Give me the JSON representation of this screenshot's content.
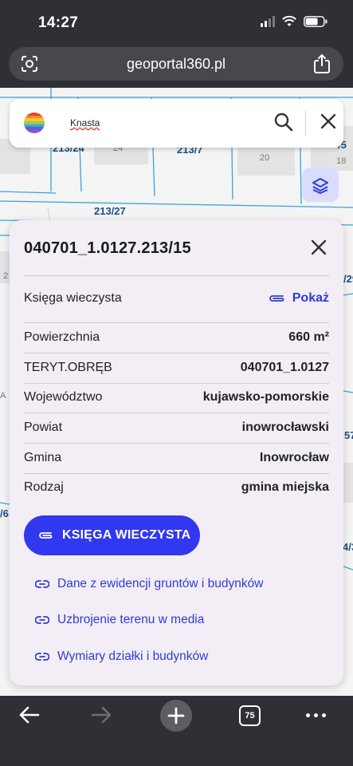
{
  "status": {
    "time": "14:27"
  },
  "browser": {
    "url": "geoportal360.pl"
  },
  "search": {
    "query": "Knasta"
  },
  "map": {
    "parcel_labels": [
      "213/24",
      "213/7",
      "213/27",
      "/5",
      "/29",
      "57",
      "/6",
      "4/3"
    ],
    "house_numbers": [
      "24",
      "20",
      "18",
      "2",
      "A"
    ]
  },
  "panel": {
    "title": "040701_1.0127.213/15",
    "ksiega": {
      "label": "Księga wieczysta",
      "link": "Pokaż"
    },
    "rows": [
      {
        "key": "Powierzchnia",
        "value": "660 m²"
      },
      {
        "key": "TERYT.OBRĘB",
        "value": "040701_1.0127"
      },
      {
        "key": "Województwo",
        "value": "kujawsko-pomorskie"
      },
      {
        "key": "Powiat",
        "value": "inowrocławski"
      },
      {
        "key": "Gmina",
        "value": "Inowrocław"
      },
      {
        "key": "Rodzaj",
        "value": "gmina miejska"
      }
    ],
    "button": "KSIĘGA WIECZYSTA",
    "links": [
      "Dane z ewidencji gruntów i budynków",
      "Uzbrojenie terenu w media",
      "Wymiary działki i budynków"
    ]
  },
  "toolbar": {
    "tab_count": "75"
  },
  "colors": {
    "accent": "#3237f0",
    "link": "#2f3bd8",
    "panel_bg": "#f3eef6",
    "parcel_line": "#3aa3d8"
  }
}
